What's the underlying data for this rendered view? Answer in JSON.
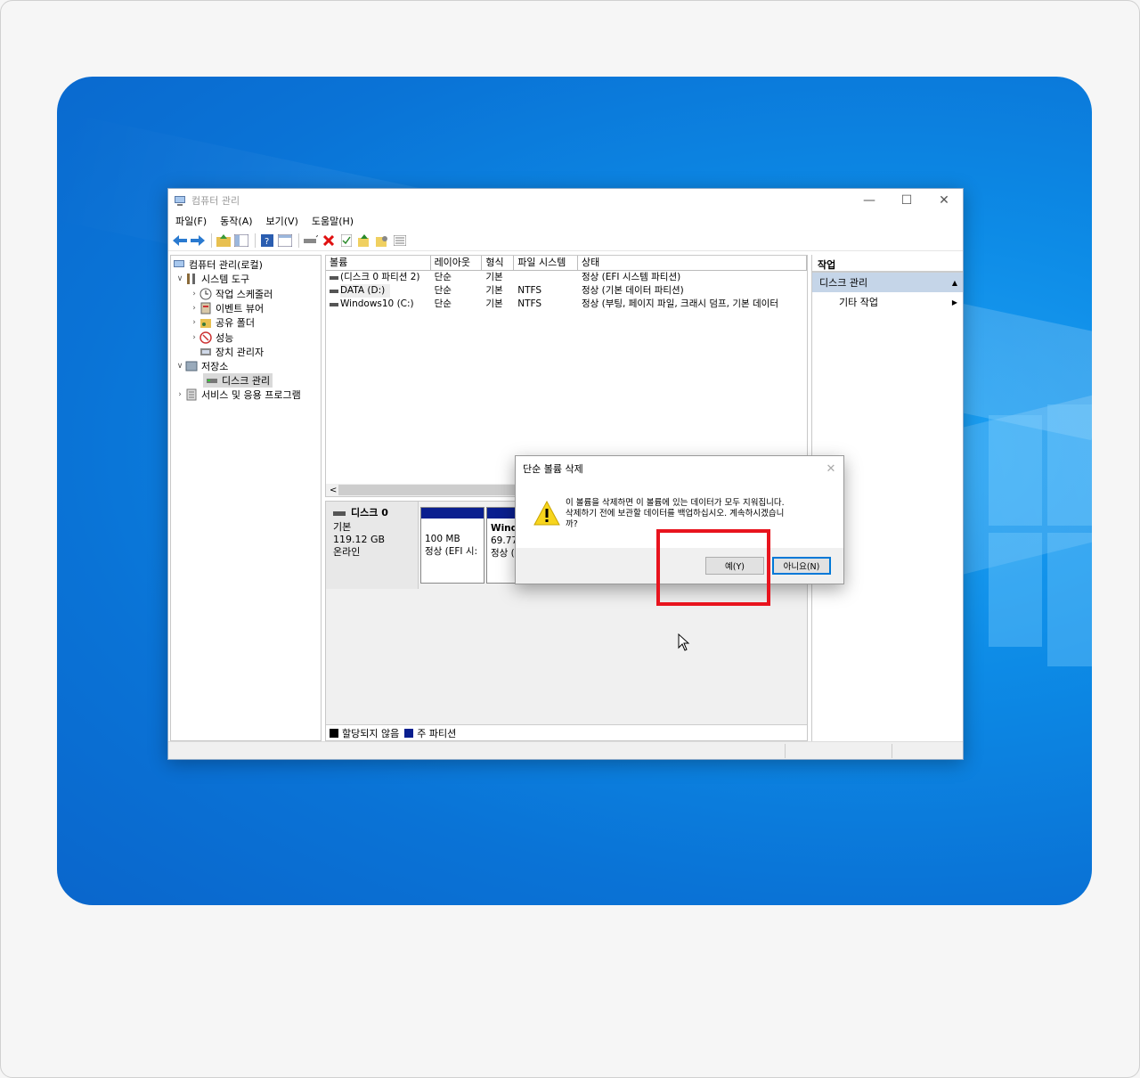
{
  "window": {
    "title": "컴퓨터 관리",
    "menus": [
      "파일(F)",
      "동작(A)",
      "보기(V)",
      "도움말(H)"
    ]
  },
  "tree": {
    "root": "컴퓨터 관리(로컬)",
    "system_tools": "시스템 도구",
    "task_scheduler": "작업 스케줄러",
    "event_viewer": "이벤트 뷰어",
    "shared_folders": "공유 폴더",
    "performance": "성능",
    "device_manager": "장치 관리자",
    "storage": "저장소",
    "disk_management": "디스크 관리",
    "services": "서비스 및 응용 프로그램"
  },
  "volumes": {
    "headers": [
      "볼륨",
      "레이아웃",
      "형식",
      "파일 시스템",
      "상태"
    ],
    "rows": [
      [
        "(디스크 0 파티션 2)",
        "단순",
        "기본",
        "",
        "정상 (EFI 시스템 파티션)"
      ],
      [
        "DATA (D:)",
        "단순",
        "기본",
        "NTFS",
        "정상 (기본 데이터 파티션)"
      ],
      [
        "Windows10 (C:)",
        "단순",
        "기본",
        "NTFS",
        "정상 (부팅, 페이지 파일, 크래시 덤프, 기본 데이터"
      ]
    ],
    "scroll_left": "<"
  },
  "disk": {
    "name": "디스크 0",
    "type": "기본",
    "size": "119.12 GB",
    "status": "온라인",
    "part1_size": "100 MB",
    "part1_status": "정상 (EFI 시:",
    "part2_name": "Wind",
    "part2_size": "69.77",
    "part2_status": "정상 ("
  },
  "legend": {
    "unallocated": "할당되지 않음",
    "primary": "주 파티션"
  },
  "actions": {
    "header": "작업",
    "selected": "디스크 관리",
    "more": "기타 작업"
  },
  "dialog": {
    "title": "단순 볼륨 삭제",
    "close": "✕",
    "message_line1": "이 볼륨을 삭제하면 이 볼륨에 있는 데이터가 모두 지워집니다.",
    "message_line2": "삭제하기 전에 보관할 데이터를 백업하십시오. 계속하시겠습니",
    "message_line3": "까?",
    "yes": "예(Y)",
    "no": "아니요(N)"
  },
  "colors": {
    "primary_partition": "#0a1f8f",
    "unallocated": "#000000",
    "highlight": "#e8141e",
    "desktop": "#0a80e0"
  }
}
